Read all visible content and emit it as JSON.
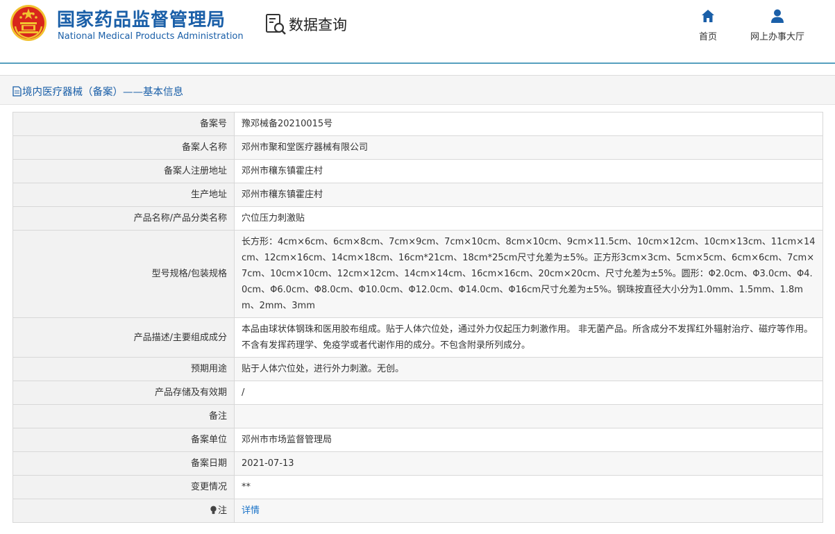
{
  "header": {
    "org_name_cn": "国家药品监督管理局",
    "org_name_en": "National Medical Products Administration",
    "query_title": "数据查询",
    "nav": [
      {
        "label": "首页",
        "icon": "home-icon"
      },
      {
        "label": "网上办事大厅",
        "icon": "user-icon"
      }
    ]
  },
  "panel": {
    "title": "境内医疗器械（备案）——基本信息"
  },
  "rows": [
    {
      "label": "备案号",
      "value": "豫邓械备20210015号"
    },
    {
      "label": "备案人名称",
      "value": "邓州市聚和堂医疗器械有限公司"
    },
    {
      "label": "备案人注册地址",
      "value": "邓州市穰东镇霍庄村"
    },
    {
      "label": "生产地址",
      "value": "邓州市穰东镇霍庄村"
    },
    {
      "label": "产品名称/产品分类名称",
      "value": "穴位压力刺激贴"
    },
    {
      "label": "型号规格/包装规格",
      "value": "长方形：4cm×6cm、6cm×8cm、7cm×9cm、7cm×10cm、8cm×10cm、9cm×11.5cm、10cm×12cm、10cm×13cm、11cm×14cm、12cm×16cm、14cm×18cm、16cm*21cm、18cm*25cm尺寸允差为±5%。正方形3cm×3cm、5cm×5cm、6cm×6cm、7cm×7cm、10cm×10cm、12cm×12cm、14cm×14cm、16cm×16cm、20cm×20cm、尺寸允差为±5%。圆形：Φ2.0cm、Φ3.0cm、Φ4.0cm、Φ6.0cm、Φ8.0cm、Φ10.0cm、Φ12.0cm、Φ14.0cm、Φ16cm尺寸允差为±5%。钢珠按直径大小分为1.0mm、1.5mm、1.8mm、2mm、3mm"
    },
    {
      "label": "产品描述/主要组成成分",
      "value": "本品由球状体钢珠和医用胶布组成。贴于人体穴位处，通过外力仅起压力刺激作用。 非无菌产品。所含成分不发挥红外辐射治疗、磁疗等作用。不含有发挥药理学、免疫学或者代谢作用的成分。不包含附录所列成分。"
    },
    {
      "label": "预期用途",
      "value": "贴于人体穴位处，进行外力刺激。无创。"
    },
    {
      "label": "产品存储及有效期",
      "value": "/"
    },
    {
      "label": "备注",
      "value": ""
    },
    {
      "label": "备案单位",
      "value": "邓州市市场监督管理局"
    },
    {
      "label": "备案日期",
      "value": "2021-07-13"
    },
    {
      "label": "变更情况",
      "value": "**"
    },
    {
      "label": "注",
      "value": "详情"
    }
  ],
  "colors": {
    "brand_blue": "#1a5fa8",
    "link_blue": "#1a73c8",
    "emblem_red": "#d8261c",
    "emblem_gold": "#f2c230"
  }
}
